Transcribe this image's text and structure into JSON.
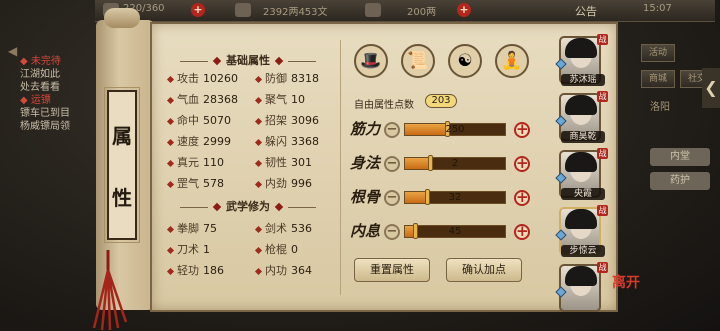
{
  "topbar": {
    "stamina": "220/360",
    "money": "2392两453文",
    "ingots": "200两",
    "notice": "公告",
    "clock": "15:07"
  },
  "quest": {
    "lines": [
      {
        "text": "◆ 未完待",
        "red": true
      },
      {
        "text": "江湖如此",
        "red": false
      },
      {
        "text": "处去看看",
        "red": false
      },
      {
        "text": "◆ 运镖",
        "red": true
      },
      {
        "text": "镖车已到目",
        "red": false
      },
      {
        "text": "杨威镖局领",
        "red": false
      }
    ]
  },
  "scroll_title": [
    "属",
    "性"
  ],
  "basic": {
    "heading": "基础属性",
    "stats": [
      {
        "label": "攻击",
        "value": "10260"
      },
      {
        "label": "防御",
        "value": "8318"
      },
      {
        "label": "气血",
        "value": "28368"
      },
      {
        "label": "聚气",
        "value": "10"
      },
      {
        "label": "命中",
        "value": "5070"
      },
      {
        "label": "招架",
        "value": "3096"
      },
      {
        "label": "速度",
        "value": "2999"
      },
      {
        "label": "躲闪",
        "value": "3368"
      },
      {
        "label": "真元",
        "value": "110"
      },
      {
        "label": "韧性",
        "value": "301"
      },
      {
        "label": "罡气",
        "value": "578"
      },
      {
        "label": "内劲",
        "value": "996"
      }
    ]
  },
  "martial": {
    "heading": "武学修为",
    "stats": [
      {
        "label": "拳脚",
        "value": "75"
      },
      {
        "label": "剑术",
        "value": "536"
      },
      {
        "label": "刀术",
        "value": "1"
      },
      {
        "label": "枪棍",
        "value": "0"
      },
      {
        "label": "轻功",
        "value": "186"
      },
      {
        "label": "内功",
        "value": "364"
      }
    ]
  },
  "skill_icons": [
    "hat-icon",
    "scroll-icon",
    "taiji-icon",
    "figure-icon"
  ],
  "free_points": {
    "label": "自由属性点数",
    "value": "203"
  },
  "points": [
    {
      "label": "筋力",
      "value": 250,
      "fraction": 0.42
    },
    {
      "label": "身法",
      "value": 2,
      "fraction": 0.25
    },
    {
      "label": "根骨",
      "value": 32,
      "fraction": 0.22
    },
    {
      "label": "内息",
      "value": 45,
      "fraction": 0.1
    }
  ],
  "buttons": {
    "reset": "重置属性",
    "confirm": "确认加点"
  },
  "characters": [
    {
      "name": "苏沐瑶"
    },
    {
      "name": "商昊乾"
    },
    {
      "name": "央霞"
    },
    {
      "name": "步惊云"
    },
    {
      "name": ""
    }
  ],
  "leave_label": "离开",
  "side_menu": [
    "活动",
    "商城",
    "社交"
  ],
  "right_panel": {
    "place": "洛阳",
    "b1": "内堂",
    "b2": "药护"
  }
}
